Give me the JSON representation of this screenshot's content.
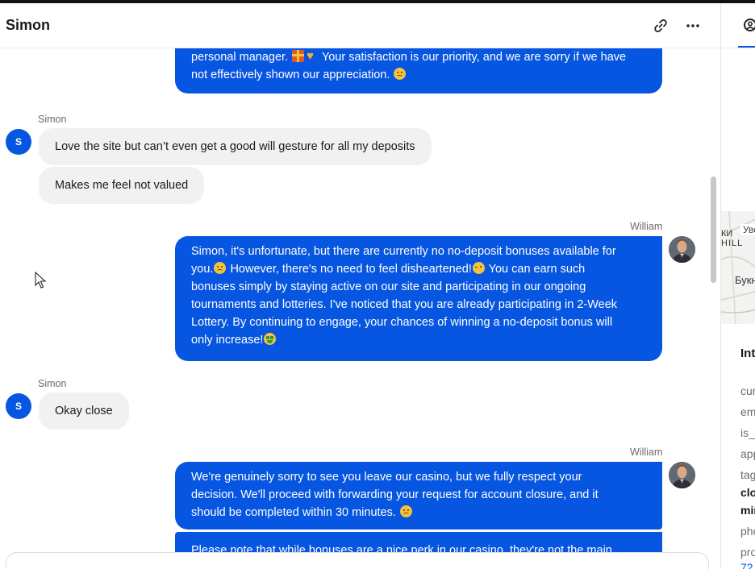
{
  "conversation": {
    "title": "Simon",
    "actions": {
      "link_icon": "link-icon",
      "more_icon": "more-horizontal-icon"
    }
  },
  "messages": [
    {
      "id": "m0",
      "author": "agent",
      "lines": [
        "personal manager. [gift][heart] Your satisfaction is our priority, and we are sorry if we have",
        "not effectively shown our appreciation. [sad]"
      ]
    },
    {
      "id": "m1",
      "author": "user",
      "sender_name": "Simon",
      "avatar_initial": "S",
      "bubbles": [
        "Love the site but can’t even get a good will gesture for all my deposits",
        "Makes me feel not valued"
      ]
    },
    {
      "id": "m2",
      "author": "agent",
      "sender_name": "William",
      "lines": [
        "Simon, it's unfortunate, but there are currently no no-deposit bonuses available for",
        "you.[sad] However, there's no need to feel disheartened![wink] You can earn such",
        "bonuses simply by staying active on our site and participating in our ongoing",
        "tournaments and lotteries. I've noticed that you are already participating in 2-Week",
        "Lottery. By continuing to engage, your chances of winning a no-deposit bonus will",
        "only increase![money]"
      ]
    },
    {
      "id": "m3",
      "author": "user",
      "sender_name": "Simon",
      "avatar_initial": "S",
      "bubbles": [
        "Okay close"
      ]
    },
    {
      "id": "m4",
      "author": "agent",
      "sender_name": "William",
      "lines": [
        "We're genuinely sorry to see you leave our casino, but we fully respect your",
        "decision. We'll proceed with forwarding your request for account closure, and it",
        "should be completed within 30 minutes. [sad]"
      ]
    },
    {
      "id": "m5",
      "author": "agent",
      "lines": [
        "Please note that while bonuses are a nice perk in our casino, they're not the main"
      ]
    }
  ],
  "side_panel": {
    "map_labels": [
      "Уве",
      "КИ",
      "HILL",
      "Букн"
    ],
    "section_title": "Int",
    "attributes": [
      "cur",
      "em",
      "is_",
      "app",
      "tag",
      "clo",
      "min",
      "pho",
      "pro",
      "72"
    ]
  },
  "colors": {
    "agent_bubble": "#0756e1",
    "user_bubble": "#f1f1f1",
    "accent": "#0756e1"
  }
}
